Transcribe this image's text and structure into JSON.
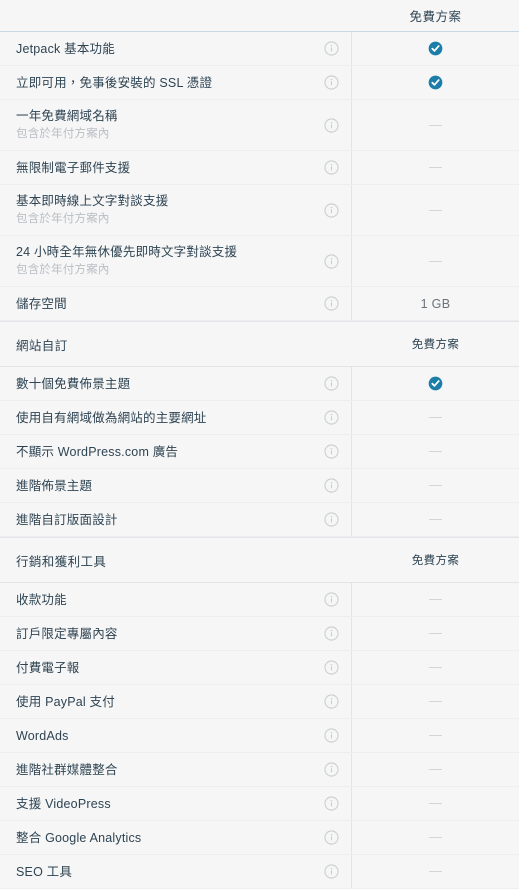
{
  "header": {
    "feature_column_label": "",
    "plan_column_label": "免費方案"
  },
  "icons": {
    "info": "info-icon",
    "included": "check-circle-icon",
    "not_included": "dash-icon"
  },
  "colors": {
    "check": "#1b7ea8",
    "info_outline": "#c8cdd1",
    "dash": "#d3d6d8",
    "row_background": "#f6f6f6",
    "divider": "#e2e4e7",
    "text": "#2e4453",
    "subtext": "#b9bfc4"
  },
  "sections": [
    {
      "title": "",
      "plan_label": "",
      "rows": [
        {
          "title": "Jetpack 基本功能",
          "sub": "",
          "value_type": "check",
          "value_text": ""
        },
        {
          "title": "立即可用，免事後安裝的 SSL 憑證",
          "sub": "",
          "value_type": "check",
          "value_text": ""
        },
        {
          "title": "一年免費網域名稱",
          "sub": "包含於年付方案內",
          "value_type": "dash",
          "value_text": ""
        },
        {
          "title": "無限制電子郵件支援",
          "sub": "",
          "value_type": "dash",
          "value_text": ""
        },
        {
          "title": "基本即時線上文字對談支援",
          "sub": "包含於年付方案內",
          "value_type": "dash",
          "value_text": ""
        },
        {
          "title": "24 小時全年無休優先即時文字對談支援",
          "sub": "包含於年付方案內",
          "value_type": "dash",
          "value_text": ""
        },
        {
          "title": "儲存空間",
          "sub": "",
          "value_type": "text",
          "value_text": "1 GB"
        }
      ]
    },
    {
      "title": "網站自訂",
      "plan_label": "免費方案",
      "rows": [
        {
          "title": "數十個免費佈景主題",
          "sub": "",
          "value_type": "check",
          "value_text": ""
        },
        {
          "title": "使用自有網域做為網站的主要網址",
          "sub": "",
          "value_type": "dash",
          "value_text": ""
        },
        {
          "title": "不顯示 WordPress.com 廣告",
          "sub": "",
          "value_type": "dash",
          "value_text": ""
        },
        {
          "title": "進階佈景主題",
          "sub": "",
          "value_type": "dash",
          "value_text": ""
        },
        {
          "title": "進階自訂版面設計",
          "sub": "",
          "value_type": "dash",
          "value_text": ""
        }
      ]
    },
    {
      "title": "行銷和獲利工具",
      "plan_label": "免費方案",
      "rows": [
        {
          "title": "收款功能",
          "sub": "",
          "value_type": "dash",
          "value_text": ""
        },
        {
          "title": "訂戶限定專屬內容",
          "sub": "",
          "value_type": "dash",
          "value_text": ""
        },
        {
          "title": "付費電子報",
          "sub": "",
          "value_type": "dash",
          "value_text": ""
        },
        {
          "title": "使用 PayPal 支付",
          "sub": "",
          "value_type": "dash",
          "value_text": ""
        },
        {
          "title": "WordAds",
          "sub": "",
          "value_type": "dash",
          "value_text": ""
        },
        {
          "title": "進階社群媒體整合",
          "sub": "",
          "value_type": "dash",
          "value_text": ""
        },
        {
          "title": "支援 VideoPress",
          "sub": "",
          "value_type": "dash",
          "value_text": ""
        },
        {
          "title": "整合 Google Analytics",
          "sub": "",
          "value_type": "dash",
          "value_text": ""
        },
        {
          "title": "SEO 工具",
          "sub": "",
          "value_type": "dash",
          "value_text": ""
        }
      ]
    }
  ]
}
